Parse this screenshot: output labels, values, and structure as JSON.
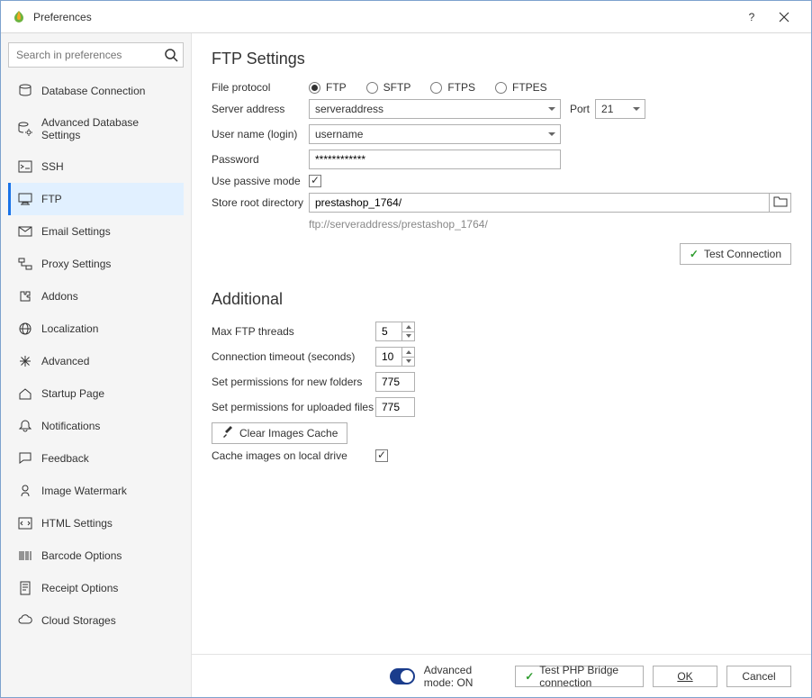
{
  "window": {
    "title": "Preferences"
  },
  "search": {
    "placeholder": "Search in preferences"
  },
  "sidebar": {
    "items": [
      {
        "label": "Database Connection"
      },
      {
        "label": "Advanced Database Settings"
      },
      {
        "label": "SSH"
      },
      {
        "label": "FTP"
      },
      {
        "label": "Email Settings"
      },
      {
        "label": "Proxy Settings"
      },
      {
        "label": "Addons"
      },
      {
        "label": "Localization"
      },
      {
        "label": "Advanced"
      },
      {
        "label": "Startup Page"
      },
      {
        "label": "Notifications"
      },
      {
        "label": "Feedback"
      },
      {
        "label": "Image Watermark"
      },
      {
        "label": "HTML Settings"
      },
      {
        "label": "Barcode Options"
      },
      {
        "label": "Receipt Options"
      },
      {
        "label": "Cloud Storages"
      }
    ],
    "selected_index": 3
  },
  "ftp": {
    "heading": "FTP Settings",
    "labels": {
      "file_protocol": "File protocol",
      "server_address": "Server address",
      "port": "Port",
      "user_name": "User name (login)",
      "password": "Password",
      "use_passive": "Use passive mode",
      "store_root": "Store root directory"
    },
    "protocols": {
      "ftp": "FTP",
      "sftp": "SFTP",
      "ftps": "FTPS",
      "ftpes": "FTPES",
      "selected": "ftp"
    },
    "server_address": "serveraddress",
    "port": "21",
    "user_name": "username",
    "password": "************",
    "use_passive": true,
    "store_root": "prestashop_1764/",
    "url_hint": "ftp://serveraddress/prestashop_1764/",
    "test_connection_label": "Test Connection"
  },
  "additional": {
    "heading": "Additional",
    "labels": {
      "max_threads": "Max FTP threads",
      "timeout": "Connection timeout (seconds)",
      "perm_folders": "Set permissions for new folders",
      "perm_files": "Set permissions for uploaded files",
      "clear_cache": "Clear Images Cache",
      "cache_local": "Cache images on local drive"
    },
    "max_threads": "5",
    "timeout": "10",
    "perm_folders": "775",
    "perm_files": "775",
    "cache_local": true
  },
  "footer": {
    "advanced_mode_label": "Advanced mode: ON",
    "test_php_label": "Test PHP Bridge connection",
    "ok_label": "OK",
    "cancel_label": "Cancel"
  }
}
